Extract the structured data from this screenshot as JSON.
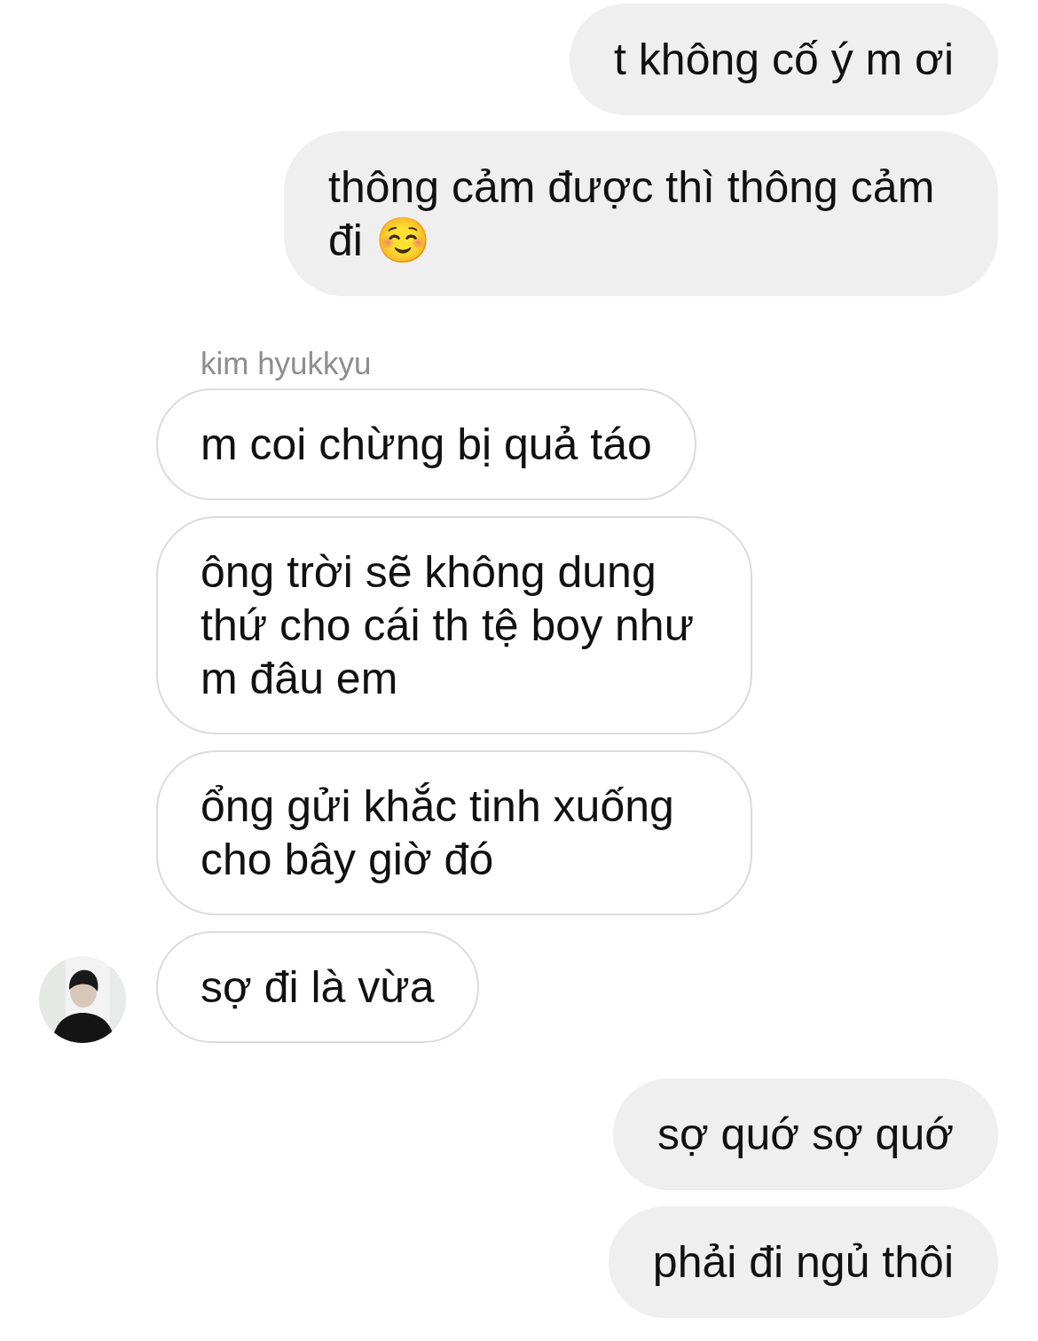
{
  "messages": [
    {
      "kind": "sent",
      "text": "t không cố ý m ơi"
    },
    {
      "kind": "sent",
      "text": "thông cảm được thì thông cảm đi ☺️"
    },
    {
      "kind": "sender_name",
      "text": "kim hyukkyu"
    },
    {
      "kind": "received",
      "text": "m coi chừng bị quả táo",
      "show_avatar": false
    },
    {
      "kind": "received",
      "text": "ông trời sẽ không dung thứ cho cái th tệ boy như m đâu em",
      "show_avatar": false
    },
    {
      "kind": "received",
      "text": "ổng gửi khắc tinh xuống cho bây giờ đó",
      "show_avatar": false
    },
    {
      "kind": "received",
      "text": "sợ đi là vừa",
      "show_avatar": true
    },
    {
      "kind": "sent",
      "text": "sợ quớ sợ quớ"
    },
    {
      "kind": "sent",
      "text": "phải đi ngủ thôi"
    }
  ]
}
